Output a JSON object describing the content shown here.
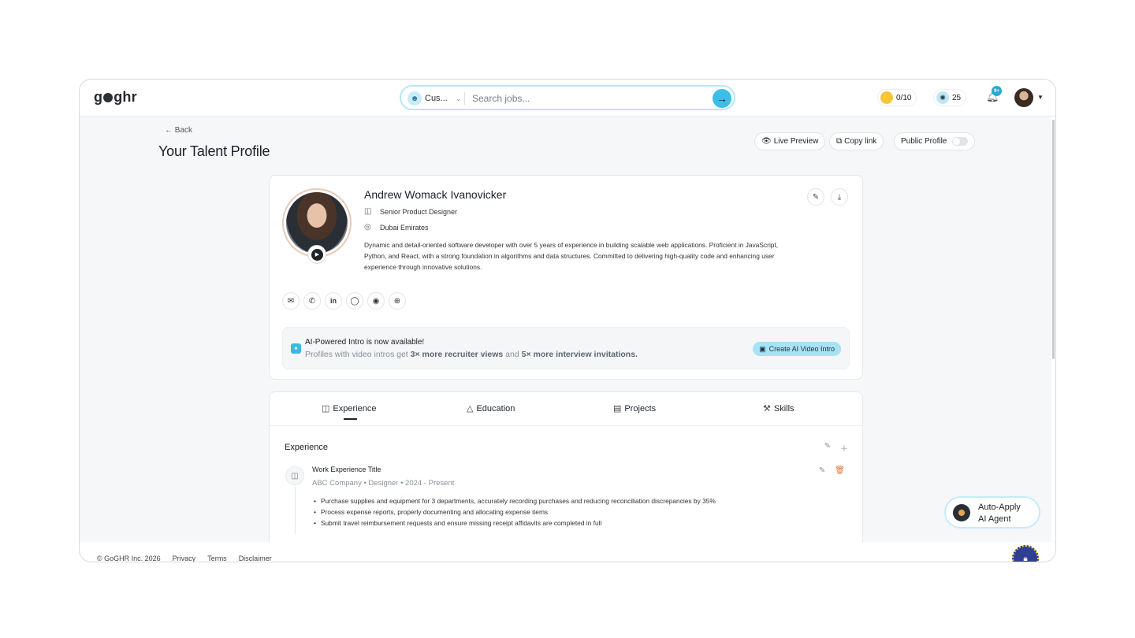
{
  "brand": {
    "logo_text_pre": "g",
    "logo_text_post": "ghr"
  },
  "search": {
    "scope_label": "Cus...",
    "placeholder": "Search jobs..."
  },
  "header": {
    "credits": "0/10",
    "coins": "25",
    "notifications_badge": "9+"
  },
  "page": {
    "back_label": "Back",
    "title": "Your Talent Profile",
    "live_preview_label": "Live Preview",
    "copy_link_label": "Copy link",
    "public_profile_label": "Public Profile"
  },
  "profile": {
    "name": "Andrew Womack Ivanovicker",
    "role": "Senior Product Designer",
    "location": "Dubai Emirates",
    "bio": "Dynamic and detail-oriented software developer with over 5 years of experience in building scalable web applications. Proficient in JavaScript, Python, and React, with a strong foundation in algorithms and data structures. Committed to delivering high-quality code and enhancing user experience through innovative solutions."
  },
  "ai_intro": {
    "title": "AI-Powered Intro is now available!",
    "sub_pre": "Profiles with video intros get ",
    "sub_b1": "3× more recruiter views",
    "sub_mid": " and ",
    "sub_b2": "5× more interview invitations.",
    "button_label": "Create AI Video Intro"
  },
  "tabs": [
    {
      "label": "Experience"
    },
    {
      "label": "Education"
    },
    {
      "label": "Projects"
    },
    {
      "label": "Skills"
    }
  ],
  "experience": {
    "section_title": "Experience",
    "job_title": "Work Experience Title",
    "job_meta": "ABC Company  •  Designer  •  2024 - Present",
    "bullets": [
      "Purchase supplies and equipment for 3 departments, accurately recording purchases and reducing reconciliation discrepancies by 35%",
      "Process expense reports, properly documenting and allocating expense items",
      "Submit travel reimbursement requests and ensure missing receipt affidavits are completed in full"
    ]
  },
  "auto_apply": {
    "line1": "Auto-Apply",
    "line2": "AI Agent"
  },
  "footer": {
    "copyright": "© GoGHR Inc. 2026",
    "privacy": "Privacy",
    "terms": "Terms",
    "disclaimer": "Disclaimer"
  },
  "colors": {
    "accent": "#3bbfe6",
    "accent_light": "#a8e2f5",
    "delete": "#e0762f"
  }
}
